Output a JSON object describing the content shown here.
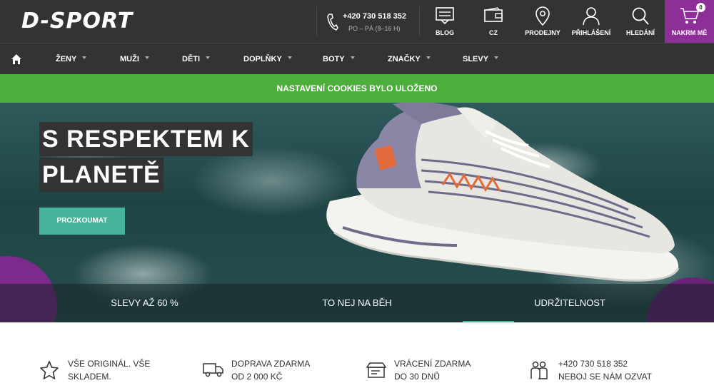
{
  "header": {
    "logo": "D-SPORT",
    "phone": "+420 730 518 352",
    "hours": "PO – PÁ (8–16 H)",
    "items": [
      {
        "label": "BLOG",
        "icon": "blog-icon"
      },
      {
        "label": "CZ",
        "icon": "wallet-icon"
      },
      {
        "label": "PRODEJNY",
        "icon": "map-pin-icon"
      },
      {
        "label": "PŘIHLÁŠENÍ",
        "icon": "user-icon"
      },
      {
        "label": "HLEDÁNÍ",
        "icon": "search-icon"
      }
    ],
    "cart": {
      "label": "NAKRM MĚ",
      "count": "0",
      "icon": "cart-icon"
    }
  },
  "nav": {
    "home_icon": "home-icon",
    "items": [
      "ŽENY",
      "MUŽI",
      "DĚTI",
      "DOPLŇKY",
      "BOTY",
      "ZNAČKY",
      "SLEVY"
    ]
  },
  "cookie": {
    "text": "NASTAVENÍ COOKIES BYLO ULOŽENO"
  },
  "hero": {
    "title_line1": "S RESPEKTEM K",
    "title_line2": "PLANETĚ",
    "button": "PROZKOUMAT",
    "tabs": [
      "SLEVY AŽ 60 %",
      "TO NEJ NA BĚH",
      "UDRŽITELNOST"
    ],
    "active_tab": 2
  },
  "features": [
    {
      "line1": "VŠE ORIGINÁL. VŠE",
      "line2": "SKLADEM.",
      "icon": "star-icon"
    },
    {
      "line1": "DOPRAVA ZDARMA",
      "line2": "OD 2 000 KČ",
      "icon": "truck-icon"
    },
    {
      "line1": "VRÁCENÍ ZDARMA",
      "line2": "DO 30 DNŮ",
      "icon": "return-box-icon"
    },
    {
      "line1": "+420 730 518 352",
      "line2": "NEBOJ SE NÁM OZVAT",
      "icon": "support-icon"
    }
  ],
  "colors": {
    "header": "#333333",
    "cart": "#8e2f98",
    "cookie": "#4cae3b",
    "accent": "#48b39b"
  }
}
